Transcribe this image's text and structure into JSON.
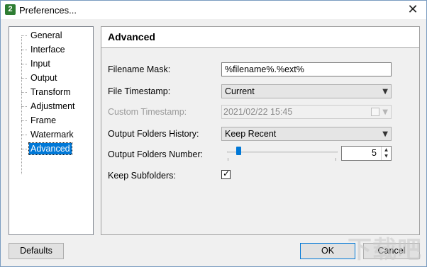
{
  "window": {
    "title": "Preferences...",
    "app_icon_text": "2",
    "close_glyph": "✕"
  },
  "tree": {
    "items": [
      {
        "label": "General",
        "selected": false
      },
      {
        "label": "Interface",
        "selected": false
      },
      {
        "label": "Input",
        "selected": false
      },
      {
        "label": "Output",
        "selected": false
      },
      {
        "label": "Transform",
        "selected": false
      },
      {
        "label": "Adjustment",
        "selected": false
      },
      {
        "label": "Frame",
        "selected": false
      },
      {
        "label": "Watermark",
        "selected": false
      },
      {
        "label": "Advanced",
        "selected": true
      }
    ]
  },
  "panel": {
    "title": "Advanced",
    "filename_mask": {
      "label": "Filename Mask:",
      "value": "%filename%.%ext%"
    },
    "file_timestamp": {
      "label": "File Timestamp:",
      "value": "Current"
    },
    "custom_timestamp": {
      "label": "Custom Timestamp:",
      "value": "2021/02/22 15:45",
      "enabled": false
    },
    "output_folders_history": {
      "label": "Output Folders History:",
      "value": "Keep Recent"
    },
    "output_folders_number": {
      "label": "Output Folders Number:",
      "value": "5",
      "slider_fraction": 0.1
    },
    "keep_subfolders": {
      "label": "Keep Subfolders:",
      "checked": true
    }
  },
  "buttons": {
    "defaults": "Defaults",
    "ok": "OK",
    "cancel": "Cancel"
  },
  "icons": {
    "dropdown_arrow": "chevron-down-icon",
    "check": "checkmark-icon",
    "spin_up": "▲",
    "spin_down": "▼"
  },
  "watermark_text": "下载吧",
  "colors": {
    "selection": "#0078d7",
    "slider_thumb": "#0078d7"
  }
}
